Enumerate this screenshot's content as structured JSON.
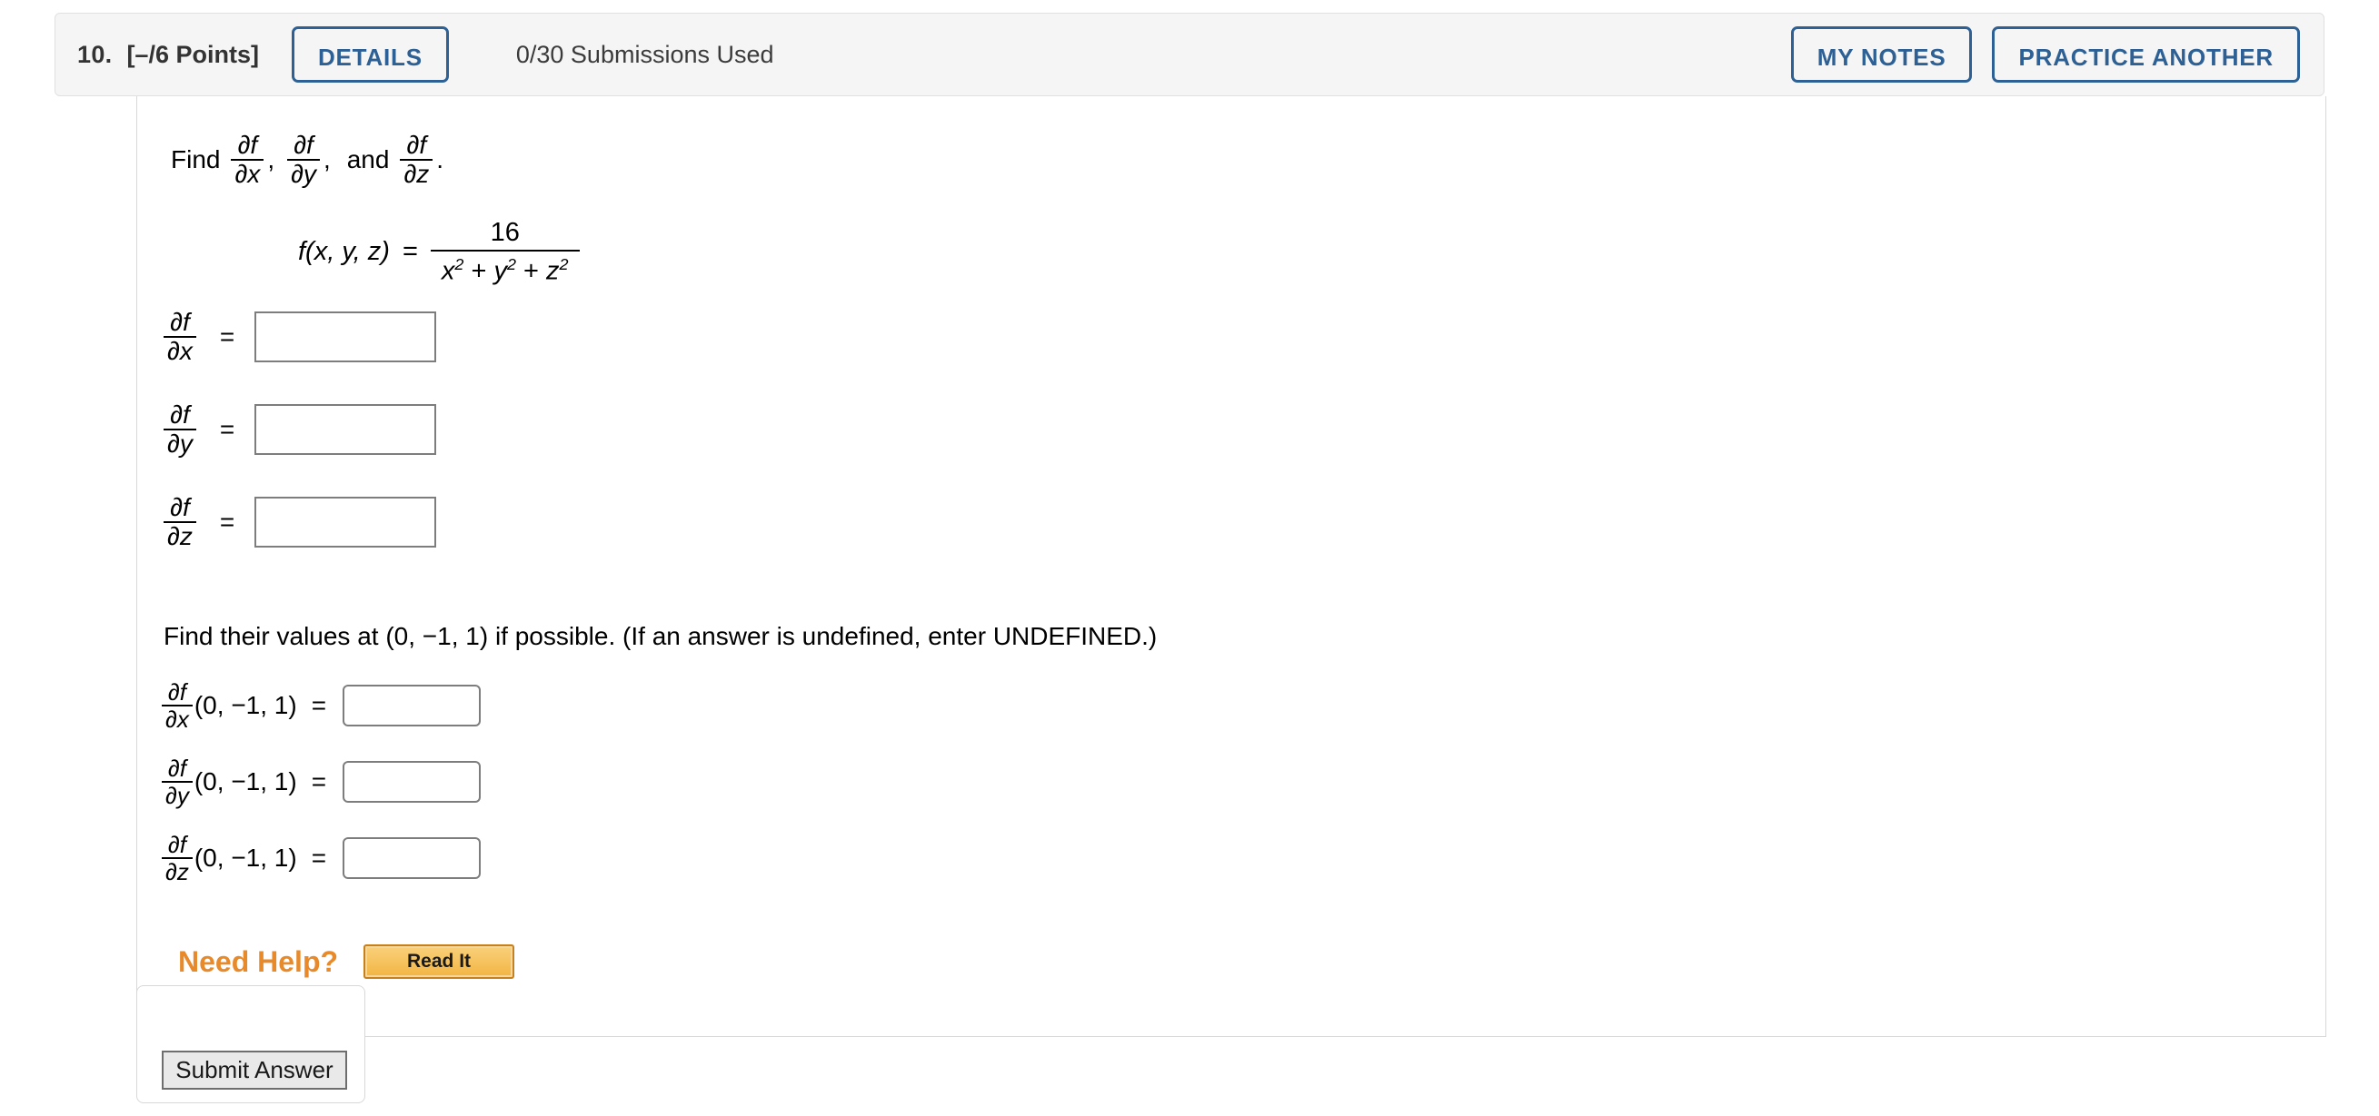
{
  "header": {
    "question_number": "10.",
    "points": "[–/6 Points]",
    "details_label": "DETAILS",
    "submissions": "0/30 Submissions Used",
    "my_notes_label": "MY NOTES",
    "practice_another_label": "PRACTICE ANOTHER",
    "accent_color": "#2d6094",
    "bar_background": "#f5f5f5"
  },
  "problem": {
    "find_prefix": "Find",
    "and_word": "and",
    "comma": ",",
    "period": ".",
    "partial_num": "∂f",
    "den_x": "∂x",
    "den_y": "∂y",
    "den_z": "∂z",
    "function_lhs": "f(x, y, z)",
    "equals": "=",
    "numerator": "16",
    "denominator": "x² + y² + z²",
    "denominator_parts": {
      "x": "x",
      "y": "y",
      "z": "z",
      "exp": "2",
      "plus": "+"
    }
  },
  "answers": {
    "equals": "=",
    "rows": [
      {
        "label_num": "∂f",
        "label_den": "∂x",
        "value": "",
        "placeholder": ""
      },
      {
        "label_num": "∂f",
        "label_den": "∂y",
        "value": "",
        "placeholder": ""
      },
      {
        "label_num": "∂f",
        "label_den": "∂z",
        "value": "",
        "placeholder": ""
      }
    ]
  },
  "part_two": {
    "prompt": "Find their values at (0, −1, 1) if possible. (If an answer is undefined, enter UNDEFINED.)",
    "point": "(0, −1, 1)",
    "equals": "=",
    "rows": [
      {
        "label_num": "∂f",
        "label_den": "∂x",
        "point": "(0, −1, 1)",
        "value": "",
        "placeholder": ""
      },
      {
        "label_num": "∂f",
        "label_den": "∂y",
        "point": "(0, −1, 1)",
        "value": "",
        "placeholder": ""
      },
      {
        "label_num": "∂f",
        "label_den": "∂z",
        "point": "(0, −1, 1)",
        "value": "",
        "placeholder": ""
      }
    ]
  },
  "help": {
    "label": "Need Help?",
    "read_it_label": "Read It",
    "label_color": "#e8892a",
    "button_color": "#f2b441"
  },
  "footer": {
    "submit_label": "Submit Answer"
  }
}
